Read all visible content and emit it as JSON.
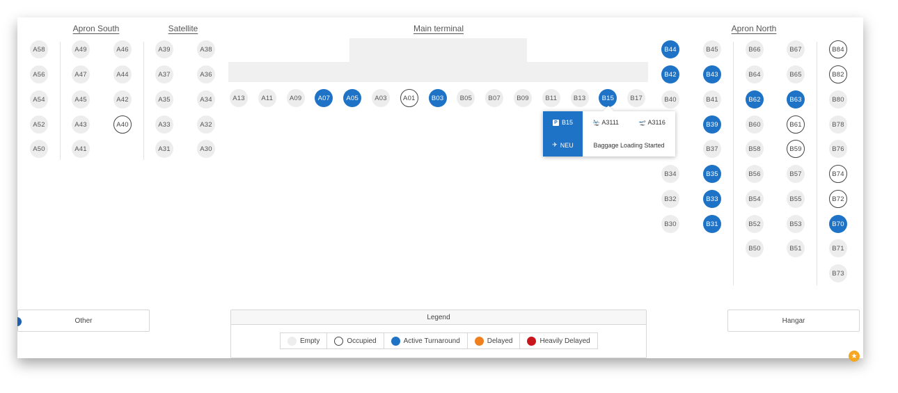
{
  "sections": {
    "apron_south": "Apron South",
    "satellite": "Satellite",
    "main_terminal": "Main terminal",
    "apron_north": "Apron North"
  },
  "status_colors": {
    "empty": "#ededed",
    "occupied": "#ffffff",
    "active": "#1e73c6",
    "delayed": "#f0801e",
    "heavily_delayed": "#c8161d"
  },
  "stands": [
    {
      "id": "A58",
      "status": "empty"
    },
    {
      "id": "A56",
      "status": "empty"
    },
    {
      "id": "A54",
      "status": "empty"
    },
    {
      "id": "A52",
      "status": "empty"
    },
    {
      "id": "A50",
      "status": "empty"
    },
    {
      "id": "A49",
      "status": "empty"
    },
    {
      "id": "A47",
      "status": "empty"
    },
    {
      "id": "A45",
      "status": "empty"
    },
    {
      "id": "A43",
      "status": "empty"
    },
    {
      "id": "A41",
      "status": "empty"
    },
    {
      "id": "A46",
      "status": "empty"
    },
    {
      "id": "A44",
      "status": "empty"
    },
    {
      "id": "A42",
      "status": "empty"
    },
    {
      "id": "A40",
      "status": "occupied"
    },
    {
      "id": "A39",
      "status": "empty"
    },
    {
      "id": "A37",
      "status": "empty"
    },
    {
      "id": "A35",
      "status": "empty"
    },
    {
      "id": "A33",
      "status": "empty"
    },
    {
      "id": "A31",
      "status": "empty"
    },
    {
      "id": "A38",
      "status": "empty"
    },
    {
      "id": "A36",
      "status": "empty"
    },
    {
      "id": "A34",
      "status": "empty"
    },
    {
      "id": "A32",
      "status": "empty"
    },
    {
      "id": "A30",
      "status": "empty"
    },
    {
      "id": "A13",
      "status": "empty"
    },
    {
      "id": "A11",
      "status": "empty"
    },
    {
      "id": "A09",
      "status": "empty"
    },
    {
      "id": "A07",
      "status": "active"
    },
    {
      "id": "A05",
      "status": "active"
    },
    {
      "id": "A03",
      "status": "empty"
    },
    {
      "id": "A01",
      "status": "occupied"
    },
    {
      "id": "B03",
      "status": "active"
    },
    {
      "id": "B05",
      "status": "empty"
    },
    {
      "id": "B07",
      "status": "empty"
    },
    {
      "id": "B09",
      "status": "empty"
    },
    {
      "id": "B11",
      "status": "empty"
    },
    {
      "id": "B13",
      "status": "empty"
    },
    {
      "id": "B15",
      "status": "active"
    },
    {
      "id": "B17",
      "status": "empty"
    },
    {
      "id": "B44",
      "status": "active"
    },
    {
      "id": "B42",
      "status": "active"
    },
    {
      "id": "B40",
      "status": "empty"
    },
    {
      "id": "B34",
      "status": "empty"
    },
    {
      "id": "B32",
      "status": "empty"
    },
    {
      "id": "B30",
      "status": "empty"
    },
    {
      "id": "B45",
      "status": "empty"
    },
    {
      "id": "B43",
      "status": "active"
    },
    {
      "id": "B41",
      "status": "empty"
    },
    {
      "id": "B39",
      "status": "active"
    },
    {
      "id": "B37",
      "status": "empty"
    },
    {
      "id": "B35",
      "status": "active"
    },
    {
      "id": "B33",
      "status": "active"
    },
    {
      "id": "B31",
      "status": "active"
    },
    {
      "id": "B66",
      "status": "empty"
    },
    {
      "id": "B64",
      "status": "empty"
    },
    {
      "id": "B62",
      "status": "active"
    },
    {
      "id": "B60",
      "status": "empty"
    },
    {
      "id": "B58",
      "status": "empty"
    },
    {
      "id": "B56",
      "status": "empty"
    },
    {
      "id": "B54",
      "status": "empty"
    },
    {
      "id": "B52",
      "status": "empty"
    },
    {
      "id": "B50",
      "status": "empty"
    },
    {
      "id": "B67",
      "status": "empty"
    },
    {
      "id": "B65",
      "status": "empty"
    },
    {
      "id": "B63",
      "status": "active"
    },
    {
      "id": "B61",
      "status": "occupied"
    },
    {
      "id": "B59",
      "status": "occupied"
    },
    {
      "id": "B57",
      "status": "empty"
    },
    {
      "id": "B55",
      "status": "empty"
    },
    {
      "id": "B53",
      "status": "empty"
    },
    {
      "id": "B51",
      "status": "empty"
    },
    {
      "id": "B84",
      "status": "occupied"
    },
    {
      "id": "B82",
      "status": "occupied"
    },
    {
      "id": "B80",
      "status": "empty"
    },
    {
      "id": "B78",
      "status": "empty"
    },
    {
      "id": "B76",
      "status": "empty"
    },
    {
      "id": "B74",
      "status": "occupied"
    },
    {
      "id": "B72",
      "status": "occupied"
    },
    {
      "id": "B70",
      "status": "active"
    },
    {
      "id": "B71",
      "status": "empty"
    },
    {
      "id": "B73",
      "status": "empty"
    }
  ],
  "popup": {
    "stand": "B15",
    "arrival_flight": "A3111",
    "departure_flight": "A3116",
    "destination": "NEU",
    "status": "Baggage Loading Started",
    "stand_icon": "parking-icon",
    "arrival_icon": "plane-landing-icon",
    "departure_icon": "plane-takeoff-icon",
    "destination_icon": "plane-icon"
  },
  "buttons": {
    "other": "Other",
    "hangar": "Hangar"
  },
  "legend": {
    "title": "Legend",
    "items": [
      {
        "label": "Empty",
        "color": "#ededed"
      },
      {
        "label": "Occupied",
        "color": "#ffffff"
      },
      {
        "label": "Active Turnaround",
        "color": "#1e73c6"
      },
      {
        "label": "Delayed",
        "color": "#f0801e"
      },
      {
        "label": "Heavily Delayed",
        "color": "#c8161d"
      }
    ]
  }
}
